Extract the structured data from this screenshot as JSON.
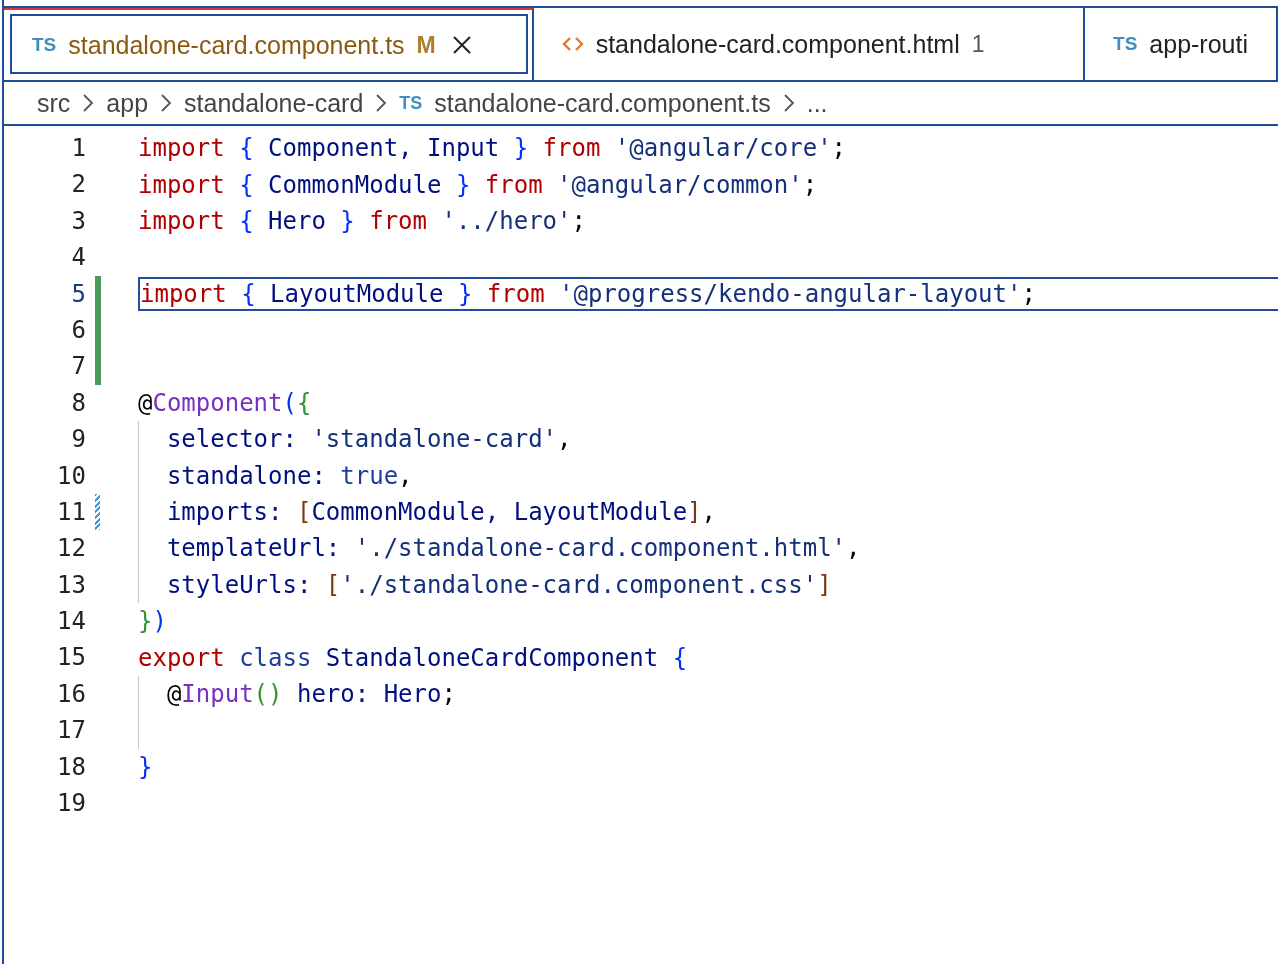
{
  "tabs": [
    {
      "kind": "ts",
      "file_type": "TS",
      "label": "standalone-card.component.ts",
      "badge": "M",
      "modified": true,
      "selected": true
    },
    {
      "kind": "html",
      "label": "standalone-card.component.html",
      "badge": "1",
      "modified": false,
      "selected": false
    },
    {
      "kind": "ts",
      "file_type": "TS",
      "label": "app-routi",
      "modified": false,
      "selected": false
    }
  ],
  "breadcrumbs": [
    {
      "label": "src"
    },
    {
      "label": "app"
    },
    {
      "label": "standalone-card"
    },
    {
      "file_type": "TS",
      "label": "standalone-card.component.ts"
    },
    {
      "label": "..."
    }
  ],
  "lines": [
    {
      "number": "1",
      "tokens": [
        {
          "text": "import ",
          "kind": "keyword"
        },
        {
          "text": "{",
          "kind": "bracket1"
        },
        {
          "text": " Component, Input ",
          "kind": "name"
        },
        {
          "text": "}",
          "kind": "bracket1"
        },
        {
          "text": " from",
          "kind": "keyword"
        },
        {
          "text": " '@angular/core'",
          "kind": "string"
        },
        {
          "text": ";",
          "kind": "plain"
        }
      ]
    },
    {
      "number": "2",
      "tokens": [
        {
          "text": "import ",
          "kind": "keyword"
        },
        {
          "text": "{",
          "kind": "bracket1"
        },
        {
          "text": " CommonModule ",
          "kind": "name"
        },
        {
          "text": "}",
          "kind": "bracket1"
        },
        {
          "text": " from",
          "kind": "keyword"
        },
        {
          "text": " '@angular/common'",
          "kind": "string"
        },
        {
          "text": ";",
          "kind": "plain"
        }
      ]
    },
    {
      "number": "3",
      "tokens": [
        {
          "text": "import ",
          "kind": "keyword"
        },
        {
          "text": "{",
          "kind": "bracket1"
        },
        {
          "text": " Hero ",
          "kind": "name"
        },
        {
          "text": "}",
          "kind": "bracket1"
        },
        {
          "text": " from",
          "kind": "keyword"
        },
        {
          "text": " '../hero'",
          "kind": "string"
        },
        {
          "text": ";",
          "kind": "plain"
        }
      ]
    },
    {
      "number": "4"
    },
    {
      "number": "5",
      "current": true,
      "kind": "added",
      "tokens": [
        {
          "text": "import ",
          "kind": "keyword"
        },
        {
          "text": "{",
          "kind": "bracket1"
        },
        {
          "text": " LayoutModule ",
          "kind": "name"
        },
        {
          "text": "}",
          "kind": "bracket1"
        },
        {
          "text": " from",
          "kind": "keyword"
        },
        {
          "text": " '@progress/kendo-angular-layout'",
          "kind": "string"
        },
        {
          "text": ";",
          "kind": "plain"
        }
      ]
    },
    {
      "number": "6",
      "kind": "added"
    },
    {
      "number": "7",
      "kind": "added"
    },
    {
      "number": "8",
      "tokens": [
        {
          "text": "@",
          "kind": "plain"
        },
        {
          "text": "Component",
          "kind": "decorator"
        },
        {
          "text": "(",
          "kind": "bracket1"
        },
        {
          "text": "{",
          "kind": "bracket2"
        }
      ]
    },
    {
      "number": "9",
      "guide": true,
      "tokens": [
        {
          "text": "  selector: ",
          "kind": "name"
        },
        {
          "text": "'standalone-card'",
          "kind": "string"
        },
        {
          "text": ",",
          "kind": "plain"
        }
      ]
    },
    {
      "number": "10",
      "guide": true,
      "tokens": [
        {
          "text": "  standalone: ",
          "kind": "name"
        },
        {
          "text": "true",
          "kind": "storage"
        },
        {
          "text": ",",
          "kind": "plain"
        }
      ]
    },
    {
      "number": "11",
      "guide": true,
      "kind": "modified",
      "tokens": [
        {
          "text": "  imports: ",
          "kind": "name"
        },
        {
          "text": "[",
          "kind": "bracket3"
        },
        {
          "text": "CommonModule, LayoutModule",
          "kind": "name"
        },
        {
          "text": "]",
          "kind": "bracket3"
        },
        {
          "text": ",",
          "kind": "plain"
        }
      ]
    },
    {
      "number": "12",
      "guide": true,
      "tokens": [
        {
          "text": "  templateUrl: ",
          "kind": "name"
        },
        {
          "text": "'./standalone-card.component.html'",
          "kind": "string"
        },
        {
          "text": ",",
          "kind": "plain"
        }
      ]
    },
    {
      "number": "13",
      "guide": true,
      "tokens": [
        {
          "text": "  styleUrls: ",
          "kind": "name"
        },
        {
          "text": "[",
          "kind": "bracket3"
        },
        {
          "text": "'./standalone-card.component.css'",
          "kind": "string"
        },
        {
          "text": "]",
          "kind": "bracket3"
        }
      ]
    },
    {
      "number": "14",
      "tokens": [
        {
          "text": "}",
          "kind": "bracket2"
        },
        {
          "text": ")",
          "kind": "bracket1"
        }
      ]
    },
    {
      "number": "15",
      "tokens": [
        {
          "text": "export ",
          "kind": "keyword"
        },
        {
          "text": "class",
          "kind": "storage"
        },
        {
          "text": " StandaloneCardComponent ",
          "kind": "name"
        },
        {
          "text": "{",
          "kind": "bracket1"
        }
      ]
    },
    {
      "number": "16",
      "guide": true,
      "tokens": [
        {
          "text": "  @",
          "kind": "plain"
        },
        {
          "text": "Input",
          "kind": "decorator"
        },
        {
          "text": "()",
          "kind": "bracket2"
        },
        {
          "text": " hero: Hero",
          "kind": "name"
        },
        {
          "text": ";",
          "kind": "plain"
        }
      ]
    },
    {
      "number": "17",
      "guide": true
    },
    {
      "number": "18",
      "tokens": [
        {
          "text": "}",
          "kind": "bracket1"
        }
      ]
    },
    {
      "number": "19"
    }
  ]
}
